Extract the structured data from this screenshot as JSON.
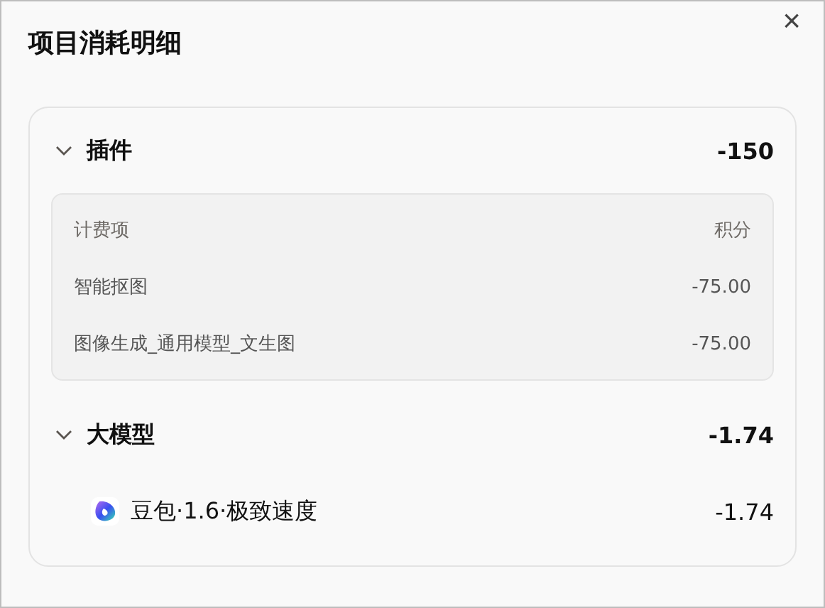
{
  "dialog": {
    "title": "项目消耗明细",
    "close": "×"
  },
  "sections": [
    {
      "kind": "table",
      "label": "插件",
      "total": "-150",
      "expanded": true,
      "columns": [
        "计费项",
        "积分"
      ],
      "rows": [
        {
          "name": "智能抠图",
          "points": "-75.00"
        },
        {
          "name": "图像生成_通用模型_文生图",
          "points": "-75.00"
        }
      ]
    },
    {
      "kind": "list",
      "label": "大模型",
      "total": "-1.74",
      "expanded": true,
      "items": [
        {
          "name": "豆包·1.6·极致速度",
          "points": "-1.74"
        }
      ]
    }
  ]
}
